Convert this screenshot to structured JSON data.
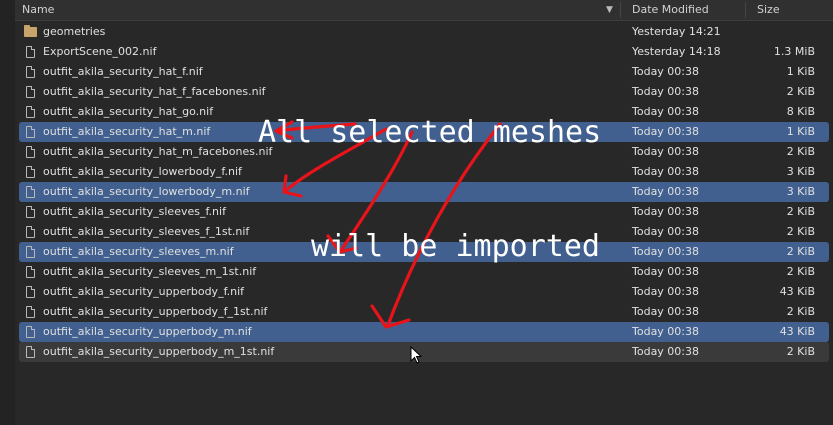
{
  "header": {
    "name_label": "Name",
    "date_label": "Date Modified",
    "size_label": "Size",
    "sort_icon": "sort-descending-icon"
  },
  "annotation": {
    "line1": "All selected meshes",
    "line2": "will be imported",
    "arrow_color": "#e8141a"
  },
  "files": [
    {
      "name": "geometries",
      "date": "Yesterday 14:21",
      "size": "",
      "type": "folder",
      "state": "normal"
    },
    {
      "name": "ExportScene_002.nif",
      "date": "Yesterday 14:18",
      "size": "1.3 MiB",
      "type": "file",
      "state": "normal"
    },
    {
      "name": "outfit_akila_security_hat_f.nif",
      "date": "Today 00:38",
      "size": "1 KiB",
      "type": "file",
      "state": "normal"
    },
    {
      "name": "outfit_akila_security_hat_f_facebones.nif",
      "date": "Today 00:38",
      "size": "2 KiB",
      "type": "file",
      "state": "normal"
    },
    {
      "name": "outfit_akila_security_hat_go.nif",
      "date": "Today 00:38",
      "size": "8 KiB",
      "type": "file",
      "state": "normal"
    },
    {
      "name": "outfit_akila_security_hat_m.nif",
      "date": "Today 00:38",
      "size": "1 KiB",
      "type": "file",
      "state": "selected"
    },
    {
      "name": "outfit_akila_security_hat_m_facebones.nif",
      "date": "Today 00:38",
      "size": "2 KiB",
      "type": "file",
      "state": "normal"
    },
    {
      "name": "outfit_akila_security_lowerbody_f.nif",
      "date": "Today 00:38",
      "size": "3 KiB",
      "type": "file",
      "state": "normal"
    },
    {
      "name": "outfit_akila_security_lowerbody_m.nif",
      "date": "Today 00:38",
      "size": "3 KiB",
      "type": "file",
      "state": "selected"
    },
    {
      "name": "outfit_akila_security_sleeves_f.nif",
      "date": "Today 00:38",
      "size": "2 KiB",
      "type": "file",
      "state": "normal"
    },
    {
      "name": "outfit_akila_security_sleeves_f_1st.nif",
      "date": "Today 00:38",
      "size": "2 KiB",
      "type": "file",
      "state": "normal"
    },
    {
      "name": "outfit_akila_security_sleeves_m.nif",
      "date": "Today 00:38",
      "size": "2 KiB",
      "type": "file",
      "state": "selected"
    },
    {
      "name": "outfit_akila_security_sleeves_m_1st.nif",
      "date": "Today 00:38",
      "size": "2 KiB",
      "type": "file",
      "state": "normal"
    },
    {
      "name": "outfit_akila_security_upperbody_f.nif",
      "date": "Today 00:38",
      "size": "43 KiB",
      "type": "file",
      "state": "normal"
    },
    {
      "name": "outfit_akila_security_upperbody_f_1st.nif",
      "date": "Today 00:38",
      "size": "2 KiB",
      "type": "file",
      "state": "normal"
    },
    {
      "name": "outfit_akila_security_upperbody_m.nif",
      "date": "Today 00:38",
      "size": "43 KiB",
      "type": "file",
      "state": "selected"
    },
    {
      "name": "outfit_akila_security_upperbody_m_1st.nif",
      "date": "Today 00:38",
      "size": "2 KiB",
      "type": "file",
      "state": "hover"
    }
  ]
}
